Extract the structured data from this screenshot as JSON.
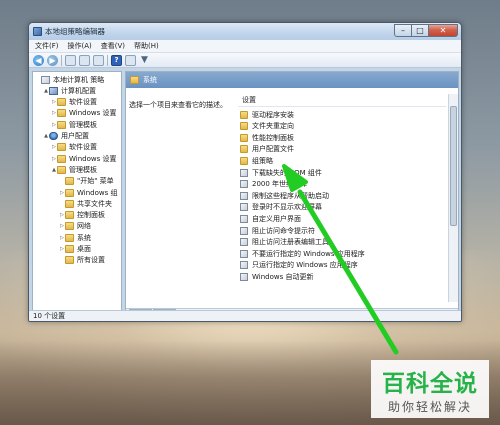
{
  "window": {
    "title": "本地组策略编辑器"
  },
  "menu": [
    "文件(F)",
    "操作(A)",
    "查看(V)",
    "帮助(H)"
  ],
  "tree": {
    "items": [
      {
        "label": "本地计算机 策略",
        "icon": "policy-icon",
        "indent": 0,
        "twisty": ""
      },
      {
        "label": "计算机配置",
        "icon": "computer-icon",
        "indent": 1,
        "twisty": "▲"
      },
      {
        "label": "软件设置",
        "icon": "folder-icon",
        "indent": 2,
        "twisty": "▷"
      },
      {
        "label": "Windows 设置",
        "icon": "folder-icon",
        "indent": 2,
        "twisty": "▷"
      },
      {
        "label": "管理模板",
        "icon": "folder-icon",
        "indent": 2,
        "twisty": "▷"
      },
      {
        "label": "用户配置",
        "icon": "user-icon",
        "indent": 1,
        "twisty": "▲"
      },
      {
        "label": "软件设置",
        "icon": "folder-icon",
        "indent": 2,
        "twisty": "▷"
      },
      {
        "label": "Windows 设置",
        "icon": "folder-icon",
        "indent": 2,
        "twisty": "▷"
      },
      {
        "label": "管理模板",
        "icon": "folder-icon",
        "indent": 2,
        "twisty": "▲"
      },
      {
        "label": "\"开始\" 菜单",
        "icon": "folder-icon",
        "indent": 3,
        "twisty": ""
      },
      {
        "label": "Windows 组",
        "icon": "folder-icon",
        "indent": 3,
        "twisty": "▷"
      },
      {
        "label": "共享文件夹",
        "icon": "folder-icon",
        "indent": 3,
        "twisty": ""
      },
      {
        "label": "控制面板",
        "icon": "folder-icon",
        "indent": 3,
        "twisty": "▷"
      },
      {
        "label": "网络",
        "icon": "folder-icon",
        "indent": 3,
        "twisty": "▷"
      },
      {
        "label": "系统",
        "icon": "folder-icon",
        "indent": 3,
        "twisty": "▷"
      },
      {
        "label": "桌面",
        "icon": "folder-icon",
        "indent": 3,
        "twisty": "▷"
      },
      {
        "label": "所有设置",
        "icon": "folder-icon",
        "indent": 3,
        "twisty": ""
      }
    ]
  },
  "right": {
    "section_title": "系统",
    "description": "选择一个项目来查看它的描述。",
    "column_header": "设置",
    "rows": [
      {
        "label": "驱动程序安装",
        "type": "folder"
      },
      {
        "label": "文件夹重定向",
        "type": "folder"
      },
      {
        "label": "性能控制面板",
        "type": "folder"
      },
      {
        "label": "用户配置文件",
        "type": "folder"
      },
      {
        "label": "组策略",
        "type": "folder"
      },
      {
        "label": "下载缺失的 COM 组件",
        "type": "policy"
      },
      {
        "label": "2000 年世纪解译",
        "type": "policy"
      },
      {
        "label": "限制这些程序从帮助启动",
        "type": "policy"
      },
      {
        "label": "登录时不显示欢迎屏幕",
        "type": "policy"
      },
      {
        "label": "自定义用户界面",
        "type": "policy"
      },
      {
        "label": "阻止访问命令提示符",
        "type": "policy"
      },
      {
        "label": "阻止访问注册表编辑工具",
        "type": "policy"
      },
      {
        "label": "不要运行指定的 Windows 应用程序",
        "type": "policy"
      },
      {
        "label": "只运行指定的 Windows 应用程序",
        "type": "policy"
      },
      {
        "label": "Windows 自动更新",
        "type": "policy"
      }
    ],
    "tabs": [
      "扩展",
      "标准"
    ]
  },
  "status": {
    "text": "10 个设置"
  },
  "watermark": {
    "title": "百科全说",
    "subtitle": "助你轻松解决"
  },
  "colors": {
    "arrow": "#22cc22",
    "watermark_green": "#27b34a",
    "header_blue": "#6a92c2"
  }
}
